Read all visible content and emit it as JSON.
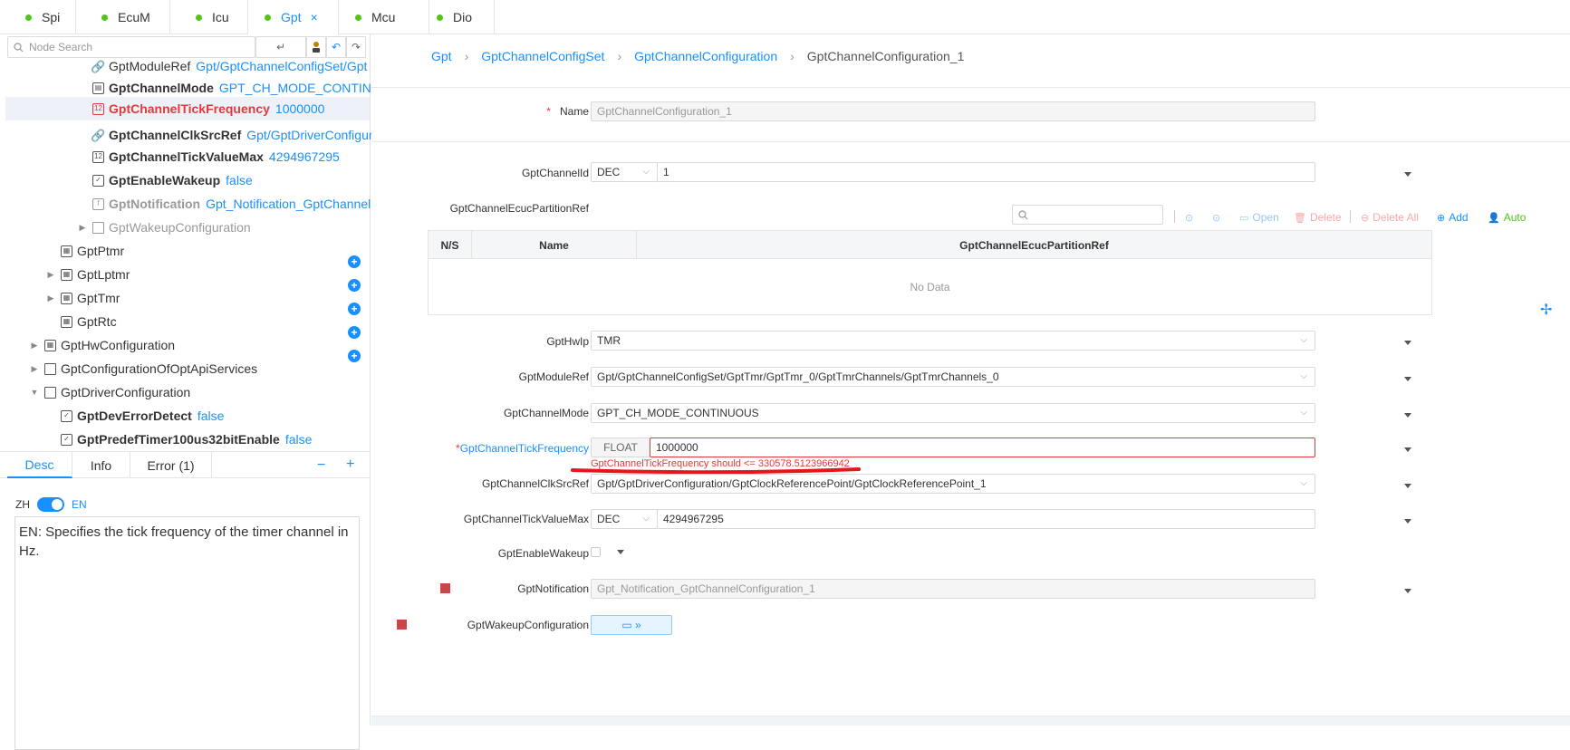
{
  "tabs": [
    {
      "label": "Spi",
      "active": false
    },
    {
      "label": "EcuM",
      "active": false
    },
    {
      "label": "Icu",
      "active": false
    },
    {
      "label": "Gpt",
      "active": true,
      "close": "×"
    },
    {
      "label": "Mcu",
      "active": false
    },
    {
      "label": "Dio",
      "active": false
    }
  ],
  "sidebar": {
    "search_placeholder": "Node Search",
    "tree": [
      {
        "name": "GptModuleRef",
        "value": "Gpt/GptChannelConfigSet/Gpt",
        "icon": "link-icon"
      },
      {
        "name": "GptChannelMode",
        "value": "GPT_CH_MODE_CONTINUC",
        "icon": "enum-icon"
      },
      {
        "name": "GptChannelTickFrequency",
        "value": "1000000",
        "icon": "float-icon"
      },
      {
        "name": "GptChannelClkSrcRef",
        "value": "Gpt/GptDriverConfigur",
        "icon": "link-icon"
      },
      {
        "name": "GptChannelTickValueMax",
        "value": "4294967295",
        "icon": "integer-icon"
      },
      {
        "name": "GptEnableWakeup",
        "value": "false",
        "icon": "checkbox-icon"
      },
      {
        "name": "GptNotification",
        "value": "Gpt_Notification_GptChannel",
        "icon": "function-icon"
      },
      {
        "name": "GptWakeupConfiguration",
        "value": "",
        "icon": "folder-icon"
      },
      {
        "name": "GptPtmr",
        "value": "",
        "icon": "table-icon"
      },
      {
        "name": "GptLptmr",
        "value": "",
        "icon": "table-icon"
      },
      {
        "name": "GptTmr",
        "value": "",
        "icon": "table-icon"
      },
      {
        "name": "GptRtc",
        "value": "",
        "icon": "table-icon"
      },
      {
        "name": "GptHwConfiguration",
        "value": "",
        "icon": "table-icon"
      },
      {
        "name": "GptConfigurationOfOptApiServices",
        "value": "",
        "icon": "folder-icon"
      },
      {
        "name": "GptDriverConfiguration",
        "value": "",
        "icon": "folder-icon"
      },
      {
        "name": "GptDevErrorDetect",
        "value": "false",
        "icon": "checkbox-icon"
      },
      {
        "name": "GptPredefTimer100us32bitEnable",
        "value": "false",
        "icon": "checkbox-icon"
      }
    ],
    "bottom_tabs": [
      "Desc",
      "Info",
      "Error (1)"
    ],
    "lang_zh": "ZH",
    "lang_en": "EN",
    "description": "EN: Specifies the tick frequency of the timer channel in Hz."
  },
  "breadcrumb": [
    "Gpt",
    "GptChannelConfigSet",
    "GptChannelConfiguration",
    "GptChannelConfiguration_1"
  ],
  "form": {
    "name_label": "Name",
    "name_required": "*",
    "name_value": "GptChannelConfiguration_1",
    "channel_id_label": "GptChannelId",
    "channel_id_format": "DEC",
    "channel_id_value": "1",
    "ecuc_ref_label": "GptChannelEcucPartitionRef",
    "toolbar": {
      "open": "Open",
      "delete": "Delete",
      "delete_all": "Delete All",
      "add": "Add",
      "auto": "Auto"
    },
    "table_headers": [
      "N/S",
      "Name",
      "GptChannelEcucPartitionRef"
    ],
    "table_empty": "No Data",
    "hwip_label": "GptHwIp",
    "hwip_value": "TMR",
    "module_ref_label": "GptModuleRef",
    "module_ref_value": "Gpt/GptChannelConfigSet/GptTmr/GptTmr_0/GptTmrChannels/GptTmrChannels_0",
    "channel_mode_label": "GptChannelMode",
    "channel_mode_value": "GPT_CH_MODE_CONTINUOUS",
    "tick_freq_label": "GptChannelTickFrequency",
    "tick_freq_required": "*",
    "tick_freq_format": "FLOAT",
    "tick_freq_value": "1000000",
    "tick_freq_error": "GptChannelTickFrequency should <= 330578.5123966942",
    "clk_src_label": "GptChannelClkSrcRef",
    "clk_src_value": "Gpt/GptDriverConfiguration/GptClockReferencePoint/GptClockReferencePoint_1",
    "tick_max_label": "GptChannelTickValueMax",
    "tick_max_format": "DEC",
    "tick_max_value": "4294967295",
    "wakeup_label": "GptEnableWakeup",
    "notification_label": "GptNotification",
    "notification_value": "Gpt_Notification_GptChannelConfiguration_1",
    "wakeup_config_label": "GptWakeupConfiguration"
  },
  "colors": {
    "accent": "#1890ff",
    "error": "#e03a3a",
    "status_dot": "#52c41a",
    "marker": "#c9474b"
  }
}
